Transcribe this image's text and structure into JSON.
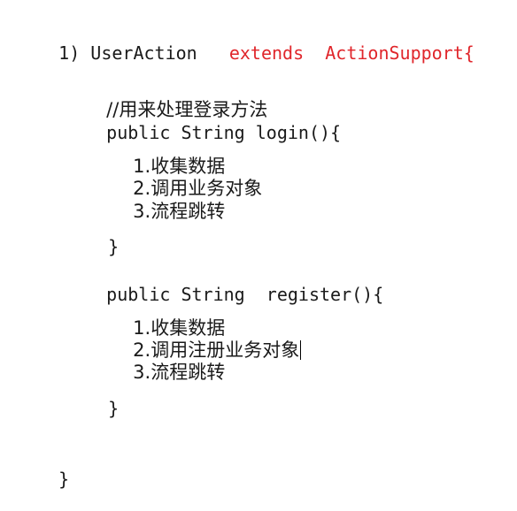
{
  "code": {
    "class_line": {
      "prefix": "1) UserAction",
      "extends_kw": "extends",
      "parent": "ActionSupport{"
    },
    "comment": "//用来处理登录方法",
    "login_sig": "public String login(){",
    "login_steps": [
      "1.收集数据",
      "2.调用业务对象",
      "3.流程跳转"
    ],
    "login_close": "}",
    "register_sig": "public String  register(){",
    "register_steps": [
      "1.收集数据",
      "2.调用注册业务对象",
      "3.流程跳转"
    ],
    "register_close": "}",
    "class_close": "}"
  },
  "colors": {
    "keyword_red": "#e0262b",
    "text": "#1a1a1a",
    "background": "#ffffff"
  }
}
